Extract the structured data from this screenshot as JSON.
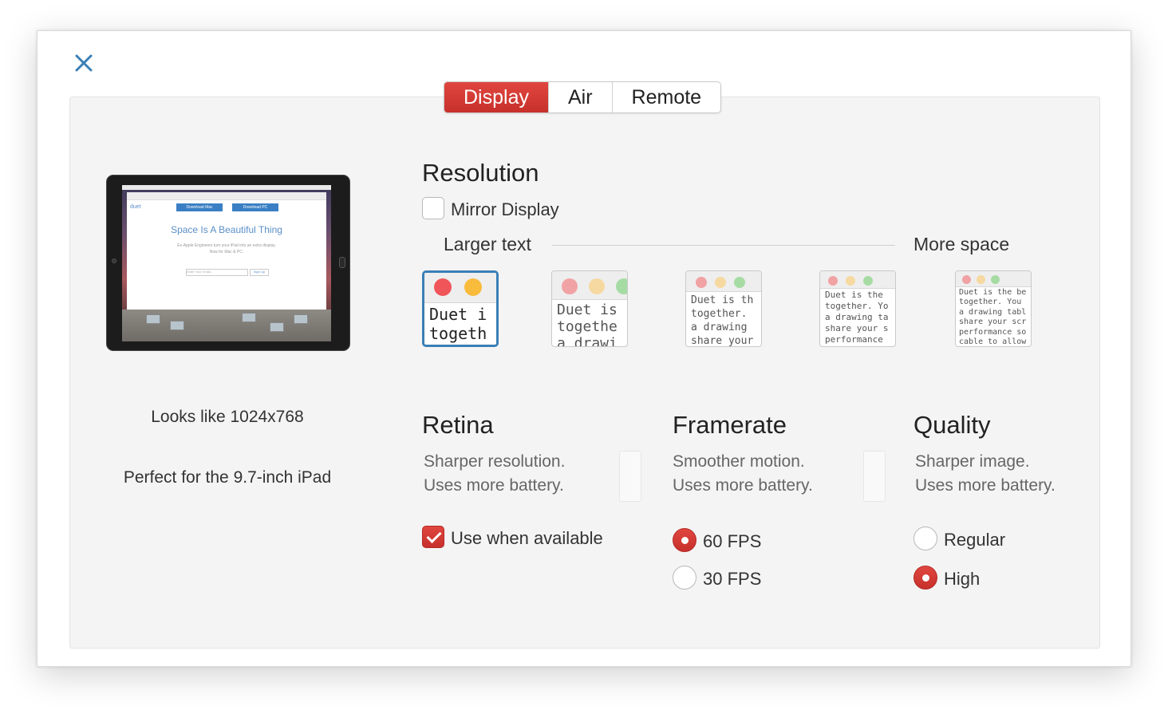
{
  "tabs": [
    {
      "label": "Display",
      "active": true
    },
    {
      "label": "Air",
      "active": false
    },
    {
      "label": "Remote",
      "active": false
    }
  ],
  "preview": {
    "brand": "duet",
    "download_mac": "Download Mac",
    "download_pc": "Download PC",
    "headline": "Space Is A Beautiful Thing",
    "subline_1": "Ex-Apple Engineers turn your iPad into an extra display.",
    "subline_2": "Now for Mac & PC.",
    "email_placeholder": "Enter Your Email...",
    "signup": "Sign Up",
    "looks_like": "Looks like 1024x768",
    "perfect_for": "Perfect for the 9.7-inch iPad"
  },
  "resolution": {
    "title": "Resolution",
    "mirror_label": "Mirror Display",
    "mirror_checked": false,
    "larger_text": "Larger text",
    "more_space": "More space",
    "options": [
      {
        "text": "Duet i\ntogeth",
        "selected": true
      },
      {
        "text": "Duet is\ntogethe\na drawi",
        "selected": false
      },
      {
        "text": "Duet is th\ntogether.\na drawing\nshare your",
        "selected": false
      },
      {
        "text": "Duet is the\ntogether. Yo\na drawing ta\nshare your s\nperformance",
        "selected": false
      },
      {
        "text": "Duet is the be\ntogether. You\na drawing tabl\nshare your scr\nperformance so\ncable to allow",
        "selected": false
      }
    ]
  },
  "retina": {
    "title": "Retina",
    "desc_1": "Sharper resolution.",
    "desc_2": "Uses more battery.",
    "checkbox_label": "Use when available",
    "checked": true
  },
  "framerate": {
    "title": "Framerate",
    "desc_1": "Smoother motion.",
    "desc_2": "Uses more battery.",
    "options": [
      {
        "label": "60 FPS",
        "checked": true
      },
      {
        "label": "30 FPS",
        "checked": false
      }
    ]
  },
  "quality": {
    "title": "Quality",
    "desc_1": "Sharper image.",
    "desc_2": "Uses more battery.",
    "options": [
      {
        "label": "Regular",
        "checked": false
      },
      {
        "label": "High",
        "checked": true
      }
    ]
  },
  "colors": {
    "accent_red": "#d63a34",
    "selection_blue": "#3a7fb6",
    "close_blue": "#3a7fb6"
  }
}
